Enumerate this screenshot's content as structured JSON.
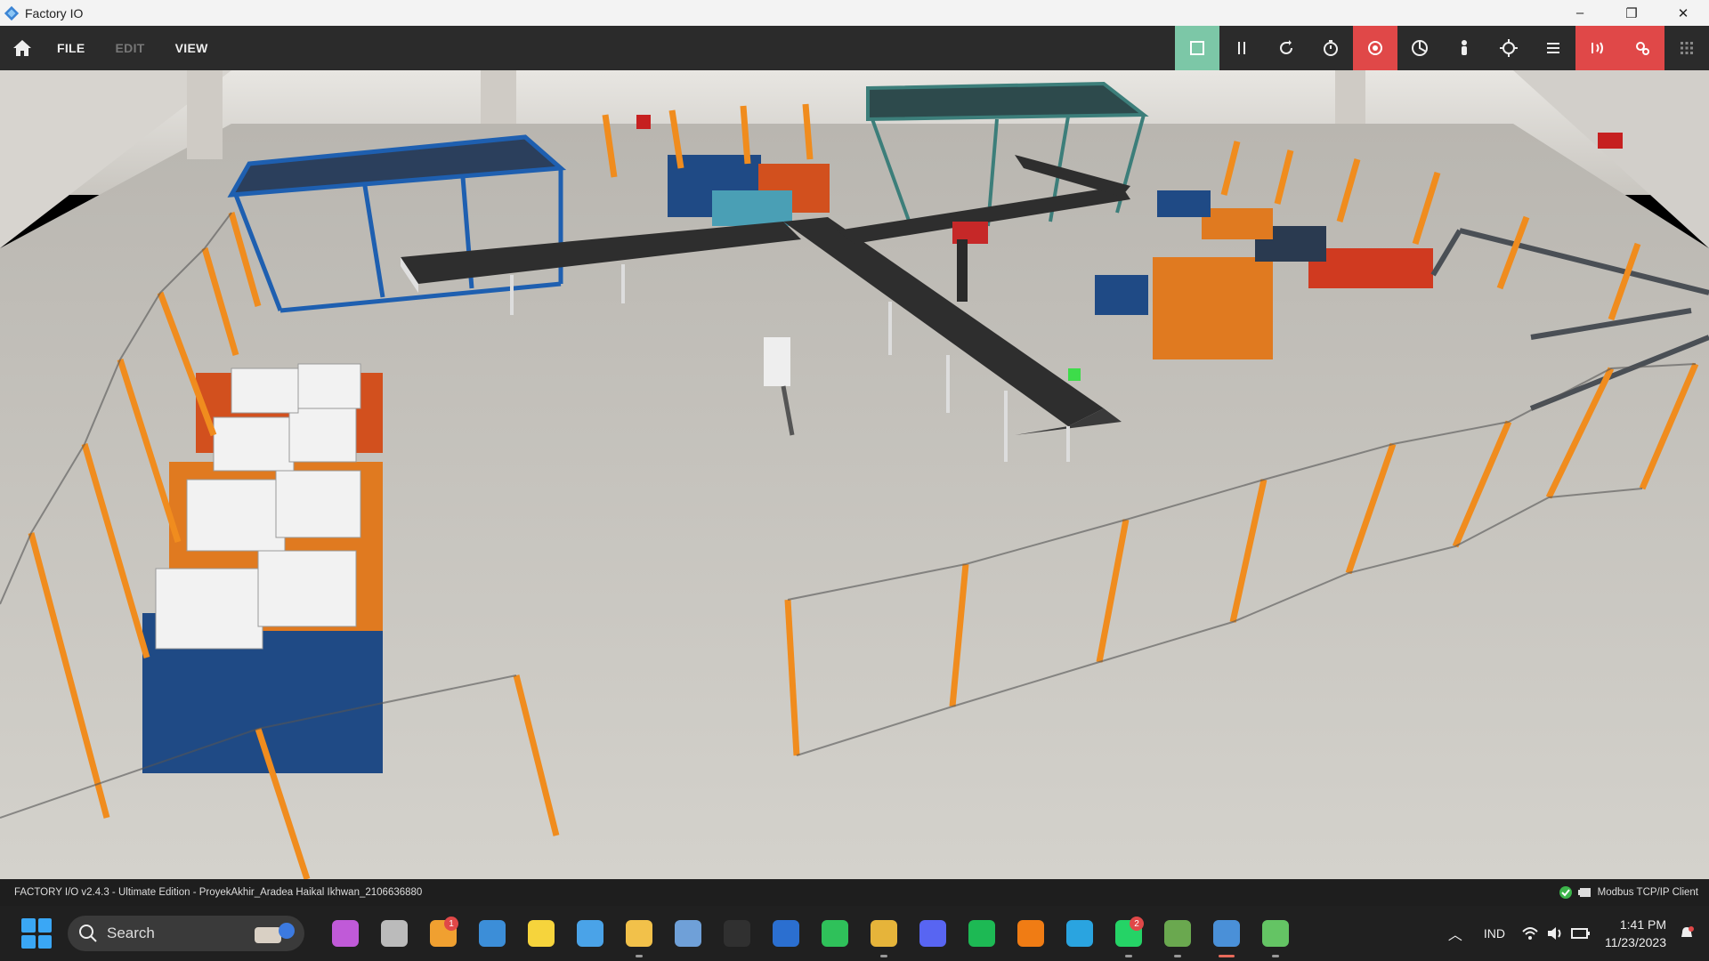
{
  "window": {
    "title": "Factory IO",
    "min_label": "–",
    "max_label": "❐",
    "close_label": "✕"
  },
  "menu": {
    "file": "FILE",
    "edit": "EDIT",
    "view": "VIEW"
  },
  "toolbar": [
    {
      "name": "play-icon",
      "color": "green"
    },
    {
      "name": "pause-icon",
      "color": "dark"
    },
    {
      "name": "reset-icon",
      "color": "dark"
    },
    {
      "name": "timer-icon",
      "color": "dark"
    },
    {
      "name": "orbit-camera-icon",
      "color": "red"
    },
    {
      "name": "fly-camera-icon",
      "color": "dark"
    },
    {
      "name": "first-person-icon",
      "color": "dark"
    },
    {
      "name": "target-icon",
      "color": "dark"
    },
    {
      "name": "list-icon",
      "color": "dark"
    },
    {
      "name": "sensor-tags-icon",
      "color": "red"
    },
    {
      "name": "drivers-icon",
      "color": "red"
    },
    {
      "name": "grid-icon",
      "color": "dark"
    }
  ],
  "status": {
    "text": "FACTORY I/O v2.4.3 - Ultimate Edition - ProyekAkhir_Aradea Haikal Ikhwan_2106636880",
    "driver": "Modbus TCP/IP Client"
  },
  "taskbar": {
    "search_label": "Search",
    "apps": [
      {
        "name": "copilot-icon",
        "color": "#c05ad8"
      },
      {
        "name": "task-view-icon",
        "color": "#bbbbbb"
      },
      {
        "name": "weather-icon",
        "color": "#f0a030",
        "badge": "1"
      },
      {
        "name": "control-panel-icon",
        "color": "#3c8ed8"
      },
      {
        "name": "sticky-notes-icon",
        "color": "#f6d43c"
      },
      {
        "name": "notepad-icon",
        "color": "#4aa3e8"
      },
      {
        "name": "file-explorer-icon",
        "color": "#f2c14a"
      },
      {
        "name": "resource-monitor-icon",
        "color": "#6fa0d8"
      },
      {
        "name": "obs-icon",
        "color": "#303030"
      },
      {
        "name": "word-icon",
        "color": "#2b6fd0"
      },
      {
        "name": "line-icon",
        "color": "#2fc15a"
      },
      {
        "name": "chrome-icon",
        "color": "#e6b43a"
      },
      {
        "name": "discord-icon",
        "color": "#5865f2"
      },
      {
        "name": "spotify-icon",
        "color": "#1db954"
      },
      {
        "name": "vlc-icon",
        "color": "#f07c14"
      },
      {
        "name": "edge-icon",
        "color": "#2aa4e0"
      },
      {
        "name": "whatsapp-icon",
        "color": "#25d366",
        "badge": "2"
      },
      {
        "name": "minecraft-icon",
        "color": "#6aa84f"
      },
      {
        "name": "factory-io-icon",
        "color": "#4a90d8"
      },
      {
        "name": "settings-app-icon",
        "color": "#64c464"
      }
    ],
    "lang": "IND",
    "time": "1:41 PM",
    "date": "11/23/2023"
  }
}
